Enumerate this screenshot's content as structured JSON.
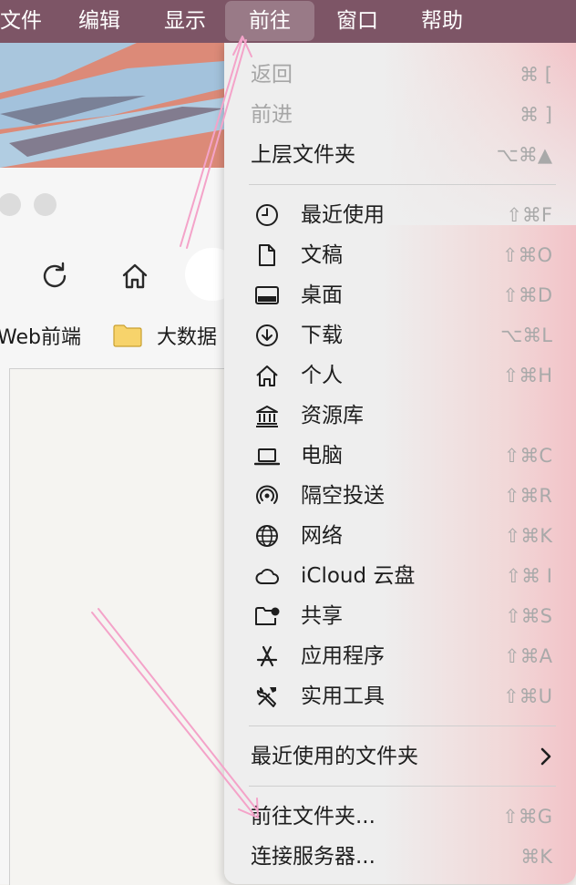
{
  "menubar": {
    "items": [
      "文件",
      "编辑",
      "显示",
      "前往",
      "窗口",
      "帮助"
    ],
    "active": "前往"
  },
  "finder_window": {
    "bookmarks": [
      "Web前端",
      "大数据"
    ]
  },
  "go_menu": {
    "top_items": [
      {
        "label": "返回",
        "shortcut": "⌘ [",
        "enabled": false
      },
      {
        "label": "前进",
        "shortcut": "⌘ ]",
        "enabled": false
      },
      {
        "label": "上层文件夹",
        "shortcut": "⌥⌘▲",
        "enabled": true
      }
    ],
    "location_items": [
      {
        "label": "最近使用",
        "shortcut": "⇧⌘F",
        "icon": "clock-icon"
      },
      {
        "label": "文稿",
        "shortcut": "⇧⌘O",
        "icon": "document-icon"
      },
      {
        "label": "桌面",
        "shortcut": "⇧⌘D",
        "icon": "desktop-icon"
      },
      {
        "label": "下载",
        "shortcut": "⌥⌘L",
        "icon": "download-icon"
      },
      {
        "label": "个人",
        "shortcut": "⇧⌘H",
        "icon": "home-icon"
      },
      {
        "label": "资源库",
        "shortcut": "",
        "icon": "library-icon"
      },
      {
        "label": "电脑",
        "shortcut": "⇧⌘C",
        "icon": "laptop-icon"
      },
      {
        "label": "隔空投送",
        "shortcut": "⇧⌘R",
        "icon": "airdrop-icon"
      },
      {
        "label": "网络",
        "shortcut": "⇧⌘K",
        "icon": "globe-icon"
      },
      {
        "label": "iCloud 云盘",
        "shortcut": "⇧⌘ I",
        "icon": "cloud-icon"
      },
      {
        "label": "共享",
        "shortcut": "⇧⌘S",
        "icon": "shared-folder-icon"
      },
      {
        "label": "应用程序",
        "shortcut": "⇧⌘A",
        "icon": "applications-icon"
      },
      {
        "label": "实用工具",
        "shortcut": "⇧⌘U",
        "icon": "utilities-icon"
      }
    ],
    "recent_folders_label": "最近使用的文件夹",
    "bottom_items": [
      {
        "label": "前往文件夹...",
        "shortcut": "⇧⌘G"
      },
      {
        "label": "连接服务器...",
        "shortcut": "⌘K"
      }
    ]
  }
}
